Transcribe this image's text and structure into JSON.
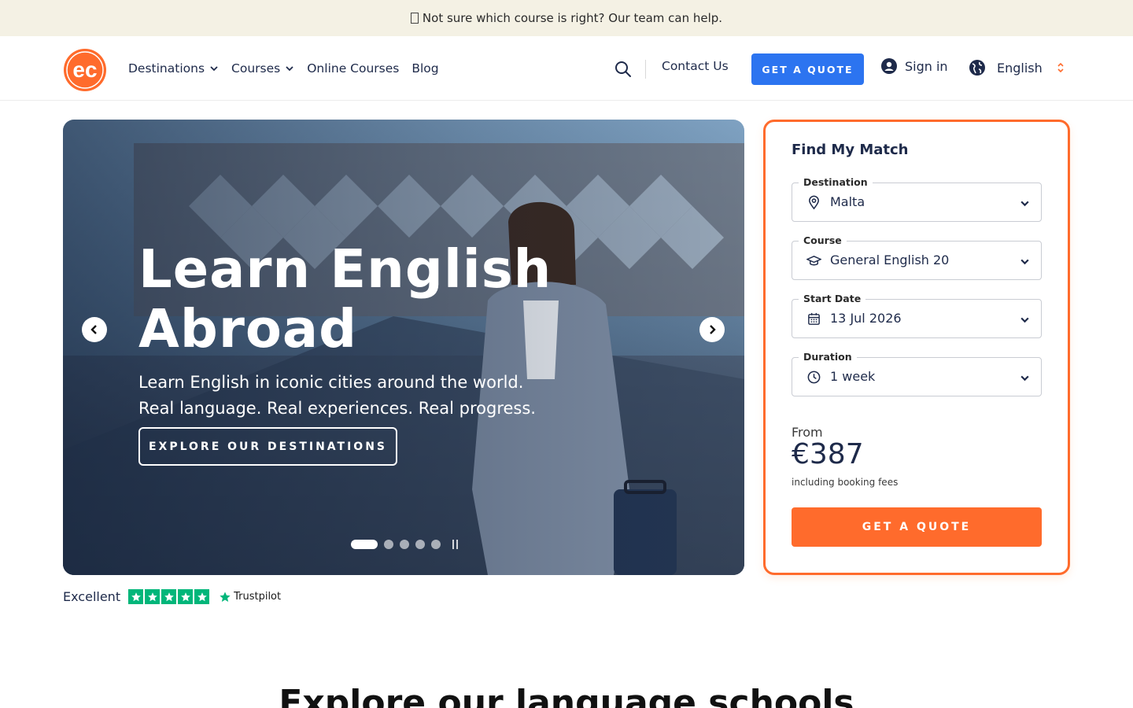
{
  "announcement": {
    "text": "Not sure which course is right? Our team can help."
  },
  "header": {
    "logo_text": "ec",
    "nav": [
      {
        "label": "Destinations",
        "has_dropdown": true
      },
      {
        "label": "Courses",
        "has_dropdown": true
      },
      {
        "label": "Online Courses",
        "has_dropdown": false
      },
      {
        "label": "Blog",
        "has_dropdown": false
      }
    ],
    "contact_label": "Contact Us",
    "quote_label": "GET A QUOTE",
    "signin_label": "Sign in",
    "language_label": "English"
  },
  "hero": {
    "title_line1": "Learn English",
    "title_line2": "Abroad",
    "subtitle_line1": "Learn English in iconic cities around the world.",
    "subtitle_line2": "Real language. Real experiences. Real progress.",
    "cta_label": "EXPLORE OUR DESTINATIONS",
    "slide_count": 5,
    "active_slide": 1
  },
  "trustpilot": {
    "rating_label": "Excellent",
    "stars": 5,
    "brand": "Trustpilot"
  },
  "match": {
    "title": "Find My Match",
    "fields": [
      {
        "label": "Destination",
        "value": "Malta",
        "icon": "map-pin-icon"
      },
      {
        "label": "Course",
        "value": "General English 20",
        "icon": "graduation-cap-icon"
      },
      {
        "label": "Start Date",
        "value": "13 Jul 2026",
        "icon": "calendar-icon"
      },
      {
        "label": "Duration",
        "value": "1 week",
        "icon": "clock-icon"
      }
    ],
    "from_label": "From",
    "price": "€387",
    "fees_note": "including booking fees",
    "quote_label": "GET A QUOTE"
  },
  "section": {
    "heading": "Explore our language schools"
  },
  "colors": {
    "accent_orange": "#ff6b2c",
    "accent_blue": "#2c74f0",
    "navy": "#1e2a4a",
    "announcement_bg": "#f4f1e4",
    "trustpilot_green": "#00b67a"
  }
}
